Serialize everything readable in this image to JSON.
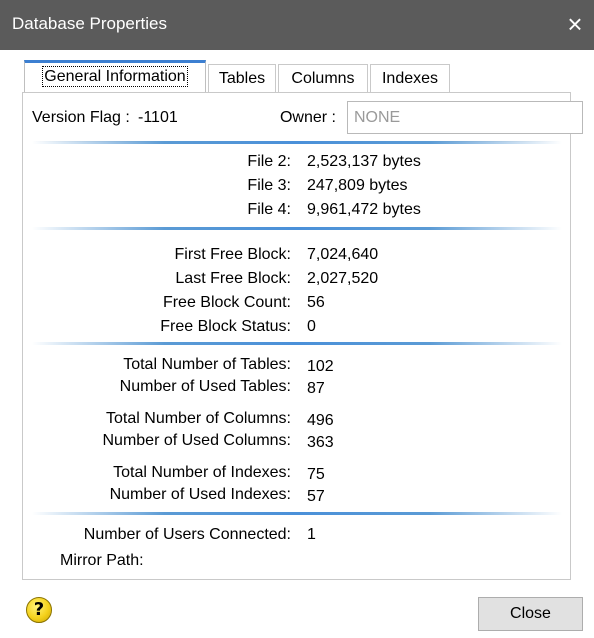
{
  "window": {
    "title": "Database Properties",
    "close_glyph": "×"
  },
  "tabs": [
    {
      "label": "General Information",
      "active": true
    },
    {
      "label": "Tables",
      "active": false
    },
    {
      "label": "Columns",
      "active": false
    },
    {
      "label": "Indexes",
      "active": false
    }
  ],
  "general": {
    "version_flag_label": "Version Flag :",
    "version_flag_value": "-1101",
    "owner_label": "Owner :",
    "owner_value": "NONE"
  },
  "files": [
    {
      "label": "File 2:",
      "value": "2,523,137 bytes"
    },
    {
      "label": "File 3:",
      "value": "247,809 bytes"
    },
    {
      "label": "File 4:",
      "value": "9,961,472 bytes"
    }
  ],
  "free_blocks": [
    {
      "label": "First Free Block:",
      "value": "7,024,640"
    },
    {
      "label": "Last Free Block:",
      "value": "2,027,520"
    },
    {
      "label": "Free Block Count:",
      "value": "56"
    },
    {
      "label": "Free Block Status:",
      "value": "0"
    }
  ],
  "counts": [
    {
      "label": "Total Number of Tables:",
      "value": "102"
    },
    {
      "label": "Number of Used Tables:",
      "value": "87"
    },
    {
      "label": "Total Number of Columns:",
      "value": "496"
    },
    {
      "label": "Number of Used Columns:",
      "value": "363"
    },
    {
      "label": "Total Number of Indexes:",
      "value": "75"
    },
    {
      "label": "Number of Used Indexes:",
      "value": "57"
    }
  ],
  "connection": {
    "users_label": "Number of Users Connected:",
    "users_value": "1",
    "mirror_label": "Mirror Path:",
    "mirror_value": ""
  },
  "footer": {
    "help_glyph": "?",
    "close_label": "Close"
  },
  "colors": {
    "titlebar": "#5b5b5b",
    "accent": "#3c7fd1",
    "separator": "#5b9bd5"
  }
}
